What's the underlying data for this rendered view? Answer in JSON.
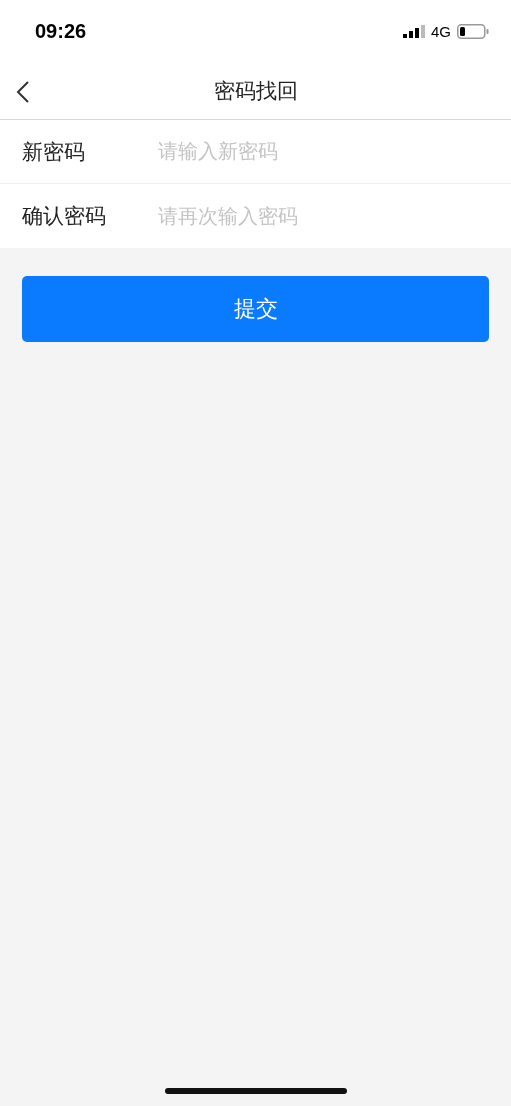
{
  "status_bar": {
    "time": "09:26",
    "network": "4G"
  },
  "nav_bar": {
    "title": "密码找回"
  },
  "fields": [
    {
      "label": "新密码",
      "placeholder": "请输入新密码"
    },
    {
      "label": "确认密码",
      "placeholder": "请再次输入密码"
    }
  ],
  "submit_button": {
    "label": "提交"
  }
}
